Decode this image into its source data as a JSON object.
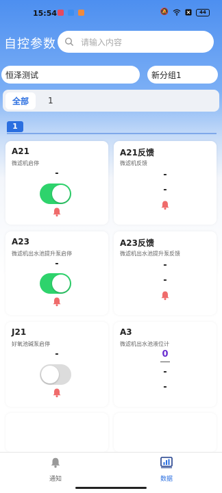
{
  "status_bar": {
    "time": "15:54",
    "battery": "44"
  },
  "header": {
    "title": "自控参数",
    "search_placeholder": "请输入内容"
  },
  "selectors": {
    "group": "恒泽测试",
    "subgroup": "新分组1"
  },
  "tabs": [
    {
      "label": "全部",
      "active": true
    },
    {
      "label": "1",
      "active": false
    }
  ],
  "section": {
    "badge": "1"
  },
  "cards": [
    {
      "title": "A21",
      "subtitle": "微滤机启停",
      "value": "-",
      "toggle": "on"
    },
    {
      "title": "A21反馈",
      "subtitle": "微滤机反馈",
      "values": [
        "-",
        "-"
      ]
    },
    {
      "title": "A23",
      "subtitle": "微滤机出水池提升泵启停",
      "value": "-",
      "toggle": "on"
    },
    {
      "title": "A23反馈",
      "subtitle": "微滤机出水池提升泵反馈",
      "values": [
        "-",
        "-"
      ]
    },
    {
      "title": "J21",
      "subtitle": "好氧池碱泵启停",
      "value": "-",
      "toggle": "off"
    },
    {
      "title": "A3",
      "subtitle": "微滤机出水池液位计",
      "number": "0",
      "values": [
        "-",
        "-"
      ]
    }
  ],
  "bottom_nav": [
    {
      "label": "通知",
      "icon": "bell-icon",
      "active": false
    },
    {
      "label": "数据",
      "icon": "chart-icon",
      "active": true
    }
  ],
  "colors": {
    "accent": "#2b6fe0",
    "toggle_on": "#2ed36c",
    "bell": "#ef6b6b",
    "number": "#6a2fd0"
  }
}
